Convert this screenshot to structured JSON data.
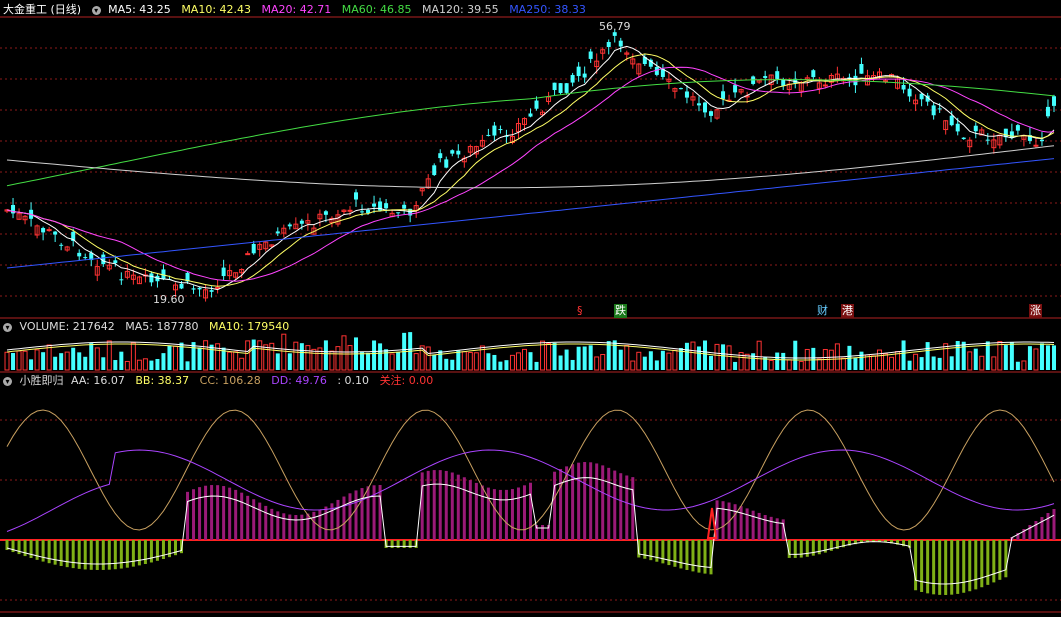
{
  "main": {
    "title": "大金重工 (日线)",
    "ma_labels": [
      {
        "text": "MA5: 43.25",
        "color": "#ffffff"
      },
      {
        "text": "MA10: 42.43",
        "color": "#ffff66"
      },
      {
        "text": "MA20: 42.71",
        "color": "#ff44ff"
      },
      {
        "text": "MA60: 46.85",
        "color": "#44dd44"
      },
      {
        "text": "MA120: 39.55",
        "color": "#d0d0d0"
      },
      {
        "text": "MA250: 38.33",
        "color": "#3355ff"
      }
    ],
    "high_label": "56.79",
    "low_label": "19.60",
    "markers": [
      {
        "text": "§",
        "color": "#ff3333",
        "bg": "#000000"
      },
      {
        "text": "跌",
        "color": "#ffffff",
        "bg": "#1b7a1b"
      },
      {
        "text": "财",
        "color": "#66ccff",
        "bg": "#000000"
      },
      {
        "text": "港",
        "color": "#ffffff",
        "bg": "#7a1010"
      },
      {
        "text": "涨",
        "color": "#ffffff",
        "bg": "#7a1010"
      }
    ]
  },
  "volume": {
    "labels": [
      {
        "text": "VOLUME: 217642",
        "color": "#dddddd"
      },
      {
        "text": "MA5: 187780",
        "color": "#dddddd"
      },
      {
        "text": "MA10: 179540",
        "color": "#ffff66"
      }
    ]
  },
  "indicator": {
    "name": "小胜即归",
    "labels": [
      {
        "text": "AA: 16.07",
        "color": "#dddddd"
      },
      {
        "text": "BB: 38.37",
        "color": "#ffff66"
      },
      {
        "text": "CC: 106.28",
        "color": "#c8a060"
      },
      {
        "text": "DD: 49.76",
        "color": "#aa44ff"
      },
      {
        "text": ": 0.10",
        "color": "#dddddd"
      },
      {
        "text": "关注: 0.00",
        "color": "#ff3333"
      }
    ]
  },
  "colors": {
    "up": "#ff3333",
    "down": "#44ffff",
    "grid": "#8b1a1a",
    "border": "#b22222",
    "ma5": "#ffffff",
    "ma10": "#ffff66",
    "ma20": "#ff44ff",
    "ma60": "#44dd44",
    "ma120": "#d0d0d0",
    "ma250": "#3355ff",
    "ind_pos": "#9b1a78",
    "ind_neg": "#7fb016",
    "cc_line": "#c8a060",
    "dd_line": "#aa44ff",
    "zero_line": "#ff2222"
  }
}
